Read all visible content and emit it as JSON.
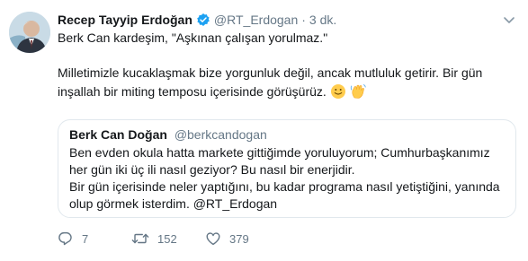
{
  "colors": {
    "text": "#14171a",
    "secondary": "#657786",
    "verified": "#1da1f2",
    "border": "#e1e8ed"
  },
  "tweet": {
    "author_name": "Recep Tayyip Erdoğan",
    "author_handle": "@RT_Erdogan",
    "separator": "·",
    "time": "3 dk.",
    "verified_icon": "verified-badge-icon",
    "text_line_1": "Berk Can kardeşim, \"Aşkınan çalışan yorulmaz.\"",
    "text_line_2": "Milletimizle kucaklaşmak bize yorgunluk değil, ancak mutluluk getirir. Bir gün",
    "text_line_3": "inşallah bir miting temposu içerisinde görüşürüz.",
    "emojis": [
      "slightly-smiling-face-icon",
      "waving-hand-icon"
    ]
  },
  "quoted_tweet": {
    "author_name": "Berk Can Doğan",
    "author_handle": "@berkcandogan",
    "line_1": "Ben evden okula hatta markete gittiğimde yoruluyorum; Cumhurbaşkanımız",
    "line_2": "her gün iki üç ili nasıl geziyor? Bu nasıl bir enerjidir.",
    "line_3": "Bir gün içerisinde neler yaptığını, bu kadar programa nasıl yetiştiğini, yanında",
    "line_4": "olup görmek isterdim. @RT_Erdogan"
  },
  "actions": {
    "reply_icon": "reply-icon",
    "reply_count": "7",
    "retweet_icon": "retweet-icon",
    "retweet_count": "152",
    "like_icon": "heart-icon",
    "like_count": "379"
  }
}
